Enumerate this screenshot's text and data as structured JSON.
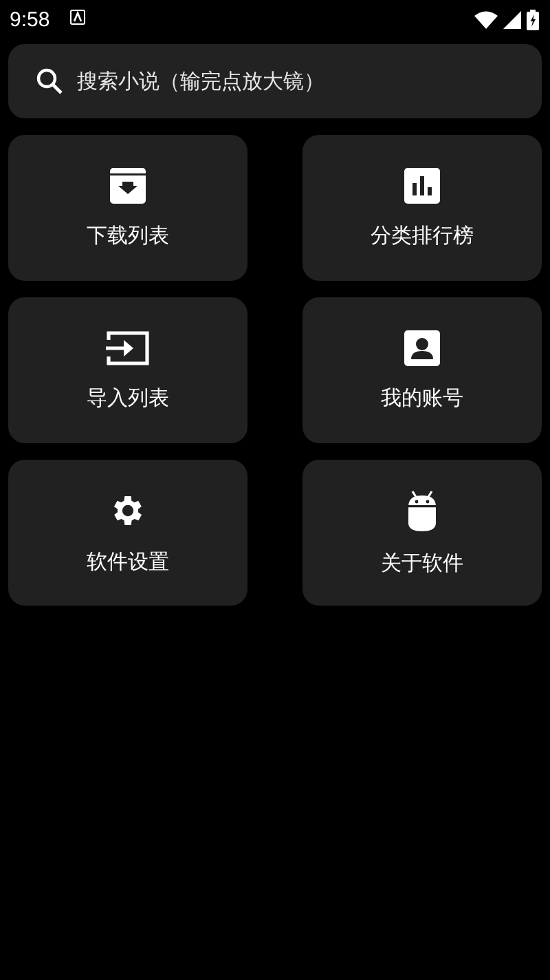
{
  "status_bar": {
    "time": "9:58"
  },
  "search": {
    "placeholder": "搜索小说（输完点放大镜）"
  },
  "menu": [
    {
      "label": "下载列表",
      "kind": "archive"
    },
    {
      "label": "分类排行榜",
      "kind": "chart"
    },
    {
      "label": "导入列表",
      "kind": "input"
    },
    {
      "label": "我的账号",
      "kind": "account"
    },
    {
      "label": "软件设置",
      "kind": "settings"
    },
    {
      "label": "关于软件",
      "kind": "robot"
    }
  ]
}
